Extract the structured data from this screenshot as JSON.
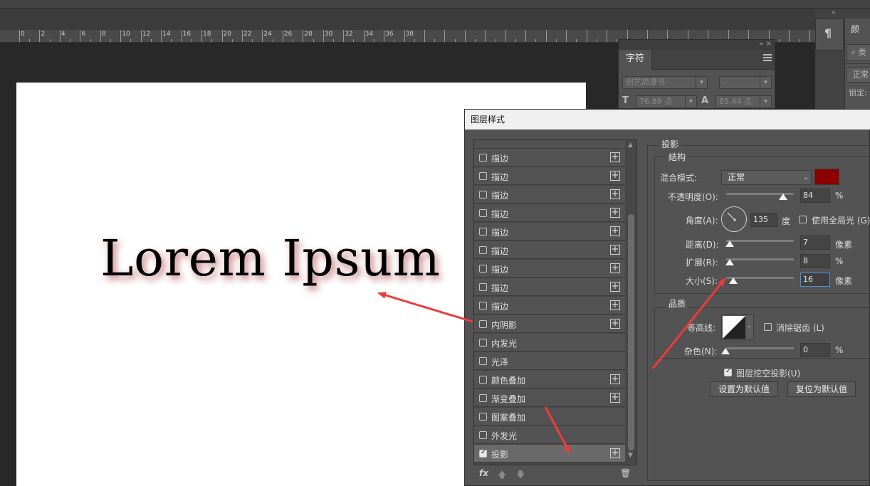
{
  "ruler_labels": [
    "0",
    "2",
    "4",
    "6",
    "8",
    "10",
    "12",
    "14",
    "16",
    "18",
    "20",
    "22",
    "24",
    "26",
    "28",
    "30",
    "32",
    "34",
    "36",
    "38"
  ],
  "canvas_text": "Lorem Ipsum",
  "character_panel": {
    "tab": "字符",
    "font_family": "创艺简隶书",
    "font_style": "-",
    "font_size": "76.89 点",
    "leading": "85.44 点"
  },
  "properties_panel": {
    "tab_partial": "颜",
    "search_partial": "类",
    "blend_partial": "正常",
    "lock_partial": "锁定:"
  },
  "dialog": {
    "title": "图层样式",
    "effects": [
      {
        "label": "描边",
        "checked": false,
        "plus": true
      },
      {
        "label": "描边",
        "checked": false,
        "plus": true
      },
      {
        "label": "描边",
        "checked": false,
        "plus": true
      },
      {
        "label": "描边",
        "checked": false,
        "plus": true
      },
      {
        "label": "描边",
        "checked": false,
        "plus": true
      },
      {
        "label": "描边",
        "checked": false,
        "plus": true
      },
      {
        "label": "描边",
        "checked": false,
        "plus": true
      },
      {
        "label": "描边",
        "checked": false,
        "plus": true
      },
      {
        "label": "描边",
        "checked": false,
        "plus": true
      },
      {
        "label": "内阴影",
        "checked": false,
        "plus": true
      },
      {
        "label": "内发光",
        "checked": false,
        "plus": false
      },
      {
        "label": "光泽",
        "checked": false,
        "plus": false
      },
      {
        "label": "颜色叠加",
        "checked": false,
        "plus": true
      },
      {
        "label": "渐变叠加",
        "checked": false,
        "plus": true
      },
      {
        "label": "图案叠加",
        "checked": false,
        "plus": false
      },
      {
        "label": "外发光",
        "checked": false,
        "plus": false
      },
      {
        "label": "投影",
        "checked": true,
        "plus": true,
        "selected": true
      }
    ],
    "bottom_icons": {
      "fx": "fx",
      "up": "🡅",
      "down": "🡇",
      "trash": "🗑"
    },
    "section_title": "投影",
    "structure": {
      "title": "结构",
      "blend_mode_label": "混合模式:",
      "blend_mode_value": "正常",
      "color": "#8c0000",
      "opacity_label": "不透明度(O):",
      "opacity_value": "84",
      "opacity_unit": "%",
      "opacity": 84,
      "angle_label": "角度(A):",
      "angle_value": "135",
      "angle_unit": "度",
      "global_light_label": "使用全局光 (G)",
      "distance_label": "距离(D):",
      "distance_value": "7",
      "distance_unit": "像素",
      "spread_label": "扩展(R):",
      "spread_value": "8",
      "spread_unit": "%",
      "size_label": "大小(S):",
      "size_value": "16",
      "size_unit": "像素"
    },
    "quality": {
      "title": "品质",
      "contour_label": "等高线:",
      "antialias_label": "消除锯齿 (L)",
      "noise_label": "杂色(N):",
      "noise_value": "0",
      "noise_unit": "%"
    },
    "knockout_label": "图层挖空投影(U)",
    "set_default": "设置为默认值",
    "reset_default": "复位为默认值"
  },
  "colors": {
    "shadow": "#8c0000",
    "arrow": "#ee3b3b"
  }
}
